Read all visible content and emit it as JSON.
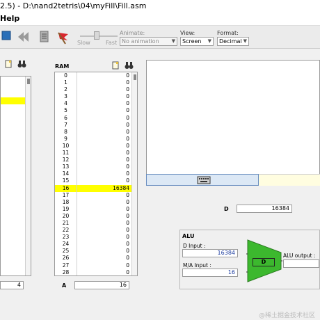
{
  "window": {
    "title": "2.5) - D:\\nand2tetris\\04\\myFill\\Fill.asm"
  },
  "menu": {
    "help": "Help"
  },
  "toolbar": {
    "slow": "Slow",
    "fast": "Fast",
    "animate_label": "Animate:",
    "animate_value": "No animation",
    "view_label": "View:",
    "view_value": "Screen",
    "format_label": "Format:",
    "format_value": "Decimal"
  },
  "rom": {
    "highlight_row_index": 3,
    "bottom_value": "4"
  },
  "ram": {
    "title": "RAM",
    "rows": [
      {
        "addr": "0",
        "val": "0"
      },
      {
        "addr": "1",
        "val": "0"
      },
      {
        "addr": "2",
        "val": "0"
      },
      {
        "addr": "3",
        "val": "0"
      },
      {
        "addr": "4",
        "val": "0"
      },
      {
        "addr": "5",
        "val": "0"
      },
      {
        "addr": "6",
        "val": "0"
      },
      {
        "addr": "7",
        "val": "0"
      },
      {
        "addr": "8",
        "val": "0"
      },
      {
        "addr": "9",
        "val": "0"
      },
      {
        "addr": "10",
        "val": "0"
      },
      {
        "addr": "11",
        "val": "0"
      },
      {
        "addr": "12",
        "val": "0"
      },
      {
        "addr": "13",
        "val": "0"
      },
      {
        "addr": "14",
        "val": "0"
      },
      {
        "addr": "15",
        "val": "0"
      },
      {
        "addr": "16",
        "val": "16384"
      },
      {
        "addr": "17",
        "val": "0"
      },
      {
        "addr": "18",
        "val": "0"
      },
      {
        "addr": "19",
        "val": "0"
      },
      {
        "addr": "20",
        "val": "0"
      },
      {
        "addr": "21",
        "val": "0"
      },
      {
        "addr": "22",
        "val": "0"
      },
      {
        "addr": "23",
        "val": "0"
      },
      {
        "addr": "24",
        "val": "0"
      },
      {
        "addr": "25",
        "val": "0"
      },
      {
        "addr": "26",
        "val": "0"
      },
      {
        "addr": "27",
        "val": "0"
      },
      {
        "addr": "28",
        "val": "0"
      }
    ],
    "highlight_addr": "16",
    "a_label": "A",
    "a_value": "16"
  },
  "d_register": {
    "label": "D",
    "value": "16384"
  },
  "alu": {
    "title": "ALU",
    "d_input_label": "D Input :",
    "d_input_value": "16384",
    "ma_input_label": "M/A Input :",
    "ma_input_value": "16",
    "op_label": "D",
    "output_label": "ALU output :"
  },
  "watermark": "@稀土掘金技术社区",
  "colors": {
    "highlight": "#ffff00",
    "alu_green": "#3cb82e",
    "value_blue": "#1a3a9e"
  }
}
